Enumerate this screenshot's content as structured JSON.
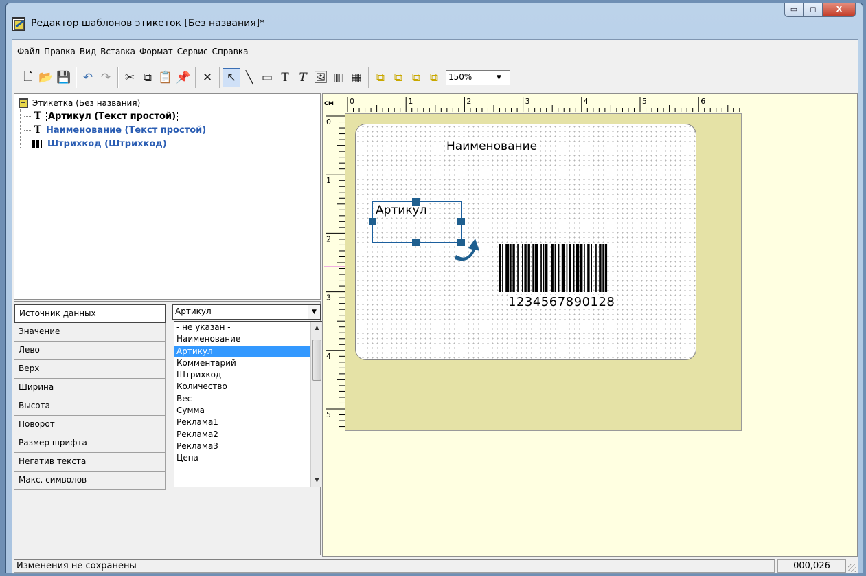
{
  "window": {
    "title": "Редактор шаблонов этикеток [Без названия]*",
    "icon": "label-editor-icon",
    "controls": {
      "minimize": "▭",
      "maximize": "◻",
      "close": "X"
    }
  },
  "menu": [
    "Файл",
    "Правка",
    "Вид",
    "Вставка",
    "Формат",
    "Сервис",
    "Справка"
  ],
  "toolbar": {
    "file_tools": [
      {
        "icon": "new-document-icon",
        "glyph": "🗋"
      },
      {
        "icon": "open-folder-icon",
        "glyph": "📂"
      },
      {
        "icon": "save-icon",
        "glyph": "💾"
      }
    ],
    "edit_tools": [
      {
        "icon": "undo-icon",
        "glyph": "↶"
      },
      {
        "icon": "redo-icon",
        "glyph": "↷"
      }
    ],
    "clipboard_tools": [
      {
        "icon": "cut-icon",
        "glyph": "✂"
      },
      {
        "icon": "copy-icon",
        "glyph": "⧉"
      },
      {
        "icon": "paste-icon",
        "glyph": "📋"
      },
      {
        "icon": "paste-special-icon",
        "glyph": "📌"
      }
    ],
    "delete_tool": {
      "icon": "delete-icon",
      "glyph": "✕"
    },
    "draw_tools": [
      {
        "icon": "pointer-icon",
        "glyph": "↖",
        "selected": true
      },
      {
        "icon": "line-icon",
        "glyph": "╲"
      },
      {
        "icon": "rectangle-icon",
        "glyph": "▭"
      },
      {
        "icon": "text-icon",
        "glyph": "T"
      },
      {
        "icon": "italic-text-icon",
        "glyph": "𝑇"
      },
      {
        "icon": "image-icon",
        "glyph": "🖼"
      },
      {
        "icon": "barcode-icon",
        "glyph": "▥"
      },
      {
        "icon": "barcode-2d-icon",
        "glyph": "▦"
      }
    ],
    "arrange_tools": [
      {
        "icon": "bring-to-front-icon",
        "glyph": "⧉"
      },
      {
        "icon": "send-to-back-icon",
        "glyph": "⧉"
      },
      {
        "icon": "bring-forward-icon",
        "glyph": "⧉"
      },
      {
        "icon": "send-backward-icon",
        "glyph": "⧉"
      }
    ],
    "zoom": "150%"
  },
  "tree": {
    "root": "Этикетка (Без названия)",
    "nodes": [
      {
        "icon": "text-object-icon",
        "label": "Артикул (Текст простой)",
        "selected": true
      },
      {
        "icon": "text-object-icon",
        "label": "Наименование (Текст простой)",
        "selected": false
      },
      {
        "icon": "barcode-object-icon",
        "label": "Штрихкод (Штрихкод)",
        "selected": false
      }
    ]
  },
  "properties": {
    "rows": [
      "Источник данных",
      "Значение",
      "Лево",
      "Верх",
      "Ширина",
      "Высота",
      "Поворот",
      "Размер шрифта",
      "Негатив текста",
      "Макс. символов"
    ],
    "data_source_value": "Артикул",
    "dropdown_options": [
      "- не указан -",
      "Наименование",
      "Артикул",
      "Комментарий",
      "Штрихкод",
      "Количество",
      "Вес",
      "Сумма",
      "Реклама1",
      "Реклама2",
      "Реклама3",
      "Цена"
    ],
    "highlighted_option": "Артикул"
  },
  "canvas": {
    "unit": "см",
    "ruler_h": [
      "0",
      "1",
      "2",
      "3",
      "4",
      "5",
      "6"
    ],
    "ruler_v": [
      "0",
      "1",
      "2",
      "3",
      "4",
      "5"
    ],
    "label_name_field": "Наименование",
    "label_article_field": "Артикул",
    "barcode_digits": "1234567890128"
  },
  "status": {
    "message": "Изменения не сохранены",
    "coords": "000,026"
  }
}
